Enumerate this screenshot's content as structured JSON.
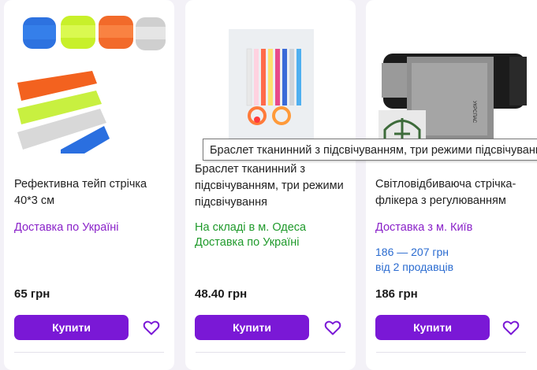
{
  "products": [
    {
      "title": "Рефективна тейп стрічка 40*3 см",
      "delivery": "Доставка по Україні",
      "price": "65 грн",
      "buy_label": "Купити",
      "image_icon": "reflective-tape-image"
    },
    {
      "title": "Браслет тканинний з підсвічуванням, три режими підсвічування",
      "stock": "На складі в м. Одеса",
      "delivery": "Доставка по Україні",
      "price": "48.40 грн",
      "buy_label": "Купити",
      "image_icon": "led-bracelet-image"
    },
    {
      "title": "Світловідбиваюча стрічка-флікера з регулюванням",
      "delivery": "Доставка з м. Київ",
      "price_range": "186 — 207 грн",
      "sellers": "від 2 продавців",
      "price": "186 грн",
      "buy_label": "Купити",
      "image_icon": "reflective-band-image",
      "image_label": "УКРСПАС"
    }
  ],
  "tooltip": "Браслет тканинний з підсвічуванням, три режими підсвічування",
  "colors": {
    "accent": "#7a18d6",
    "delivery_purple": "#8a22c9",
    "stock_green": "#1f9a2b",
    "link_blue": "#2a6bd0"
  }
}
